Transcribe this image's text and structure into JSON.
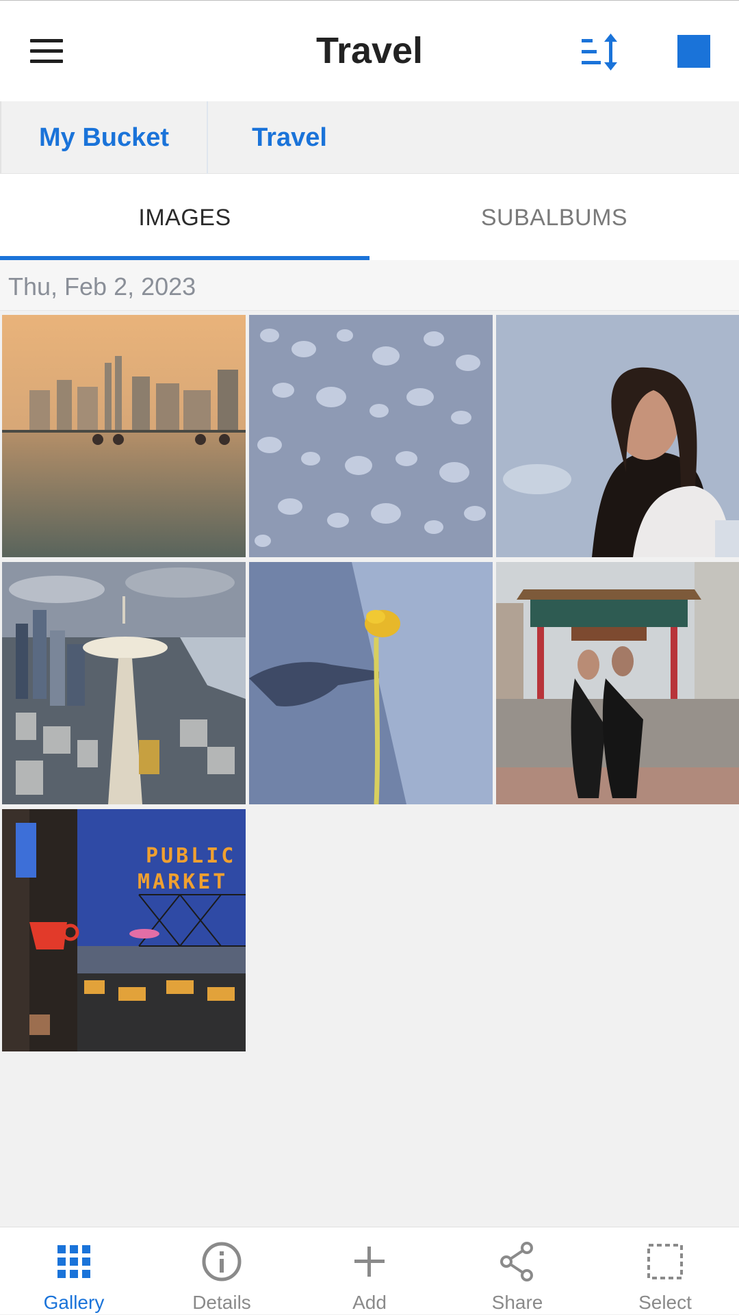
{
  "header": {
    "title": "Travel",
    "menu_icon": "hamburger-menu-icon",
    "sort_icon": "sort-icon",
    "action_icon": "square-icon",
    "accent_color": "#1a73d9"
  },
  "breadcrumb": {
    "items": [
      {
        "label": "My Bucket"
      },
      {
        "label": "Travel"
      }
    ]
  },
  "tabs": [
    {
      "label": "IMAGES",
      "selected": true
    },
    {
      "label": "SUBALBUMS",
      "selected": false
    }
  ],
  "gallery": {
    "date_header": "Thu, Feb 2, 2023",
    "images": [
      {
        "name": "infinity-pool-skyline"
      },
      {
        "name": "water-droplets"
      },
      {
        "name": "woman-portrait-sky"
      },
      {
        "name": "space-needle-city"
      },
      {
        "name": "yellow-flower-shadow"
      },
      {
        "name": "chinatown-gate-couple"
      },
      {
        "name": "public-market-sign"
      }
    ]
  },
  "bottom_nav": [
    {
      "label": "Gallery",
      "icon": "grid-icon",
      "active": true
    },
    {
      "label": "Details",
      "icon": "info-icon",
      "active": false
    },
    {
      "label": "Add",
      "icon": "plus-icon",
      "active": false
    },
    {
      "label": "Share",
      "icon": "share-icon",
      "active": false
    },
    {
      "label": "Select",
      "icon": "select-icon",
      "active": false
    }
  ]
}
